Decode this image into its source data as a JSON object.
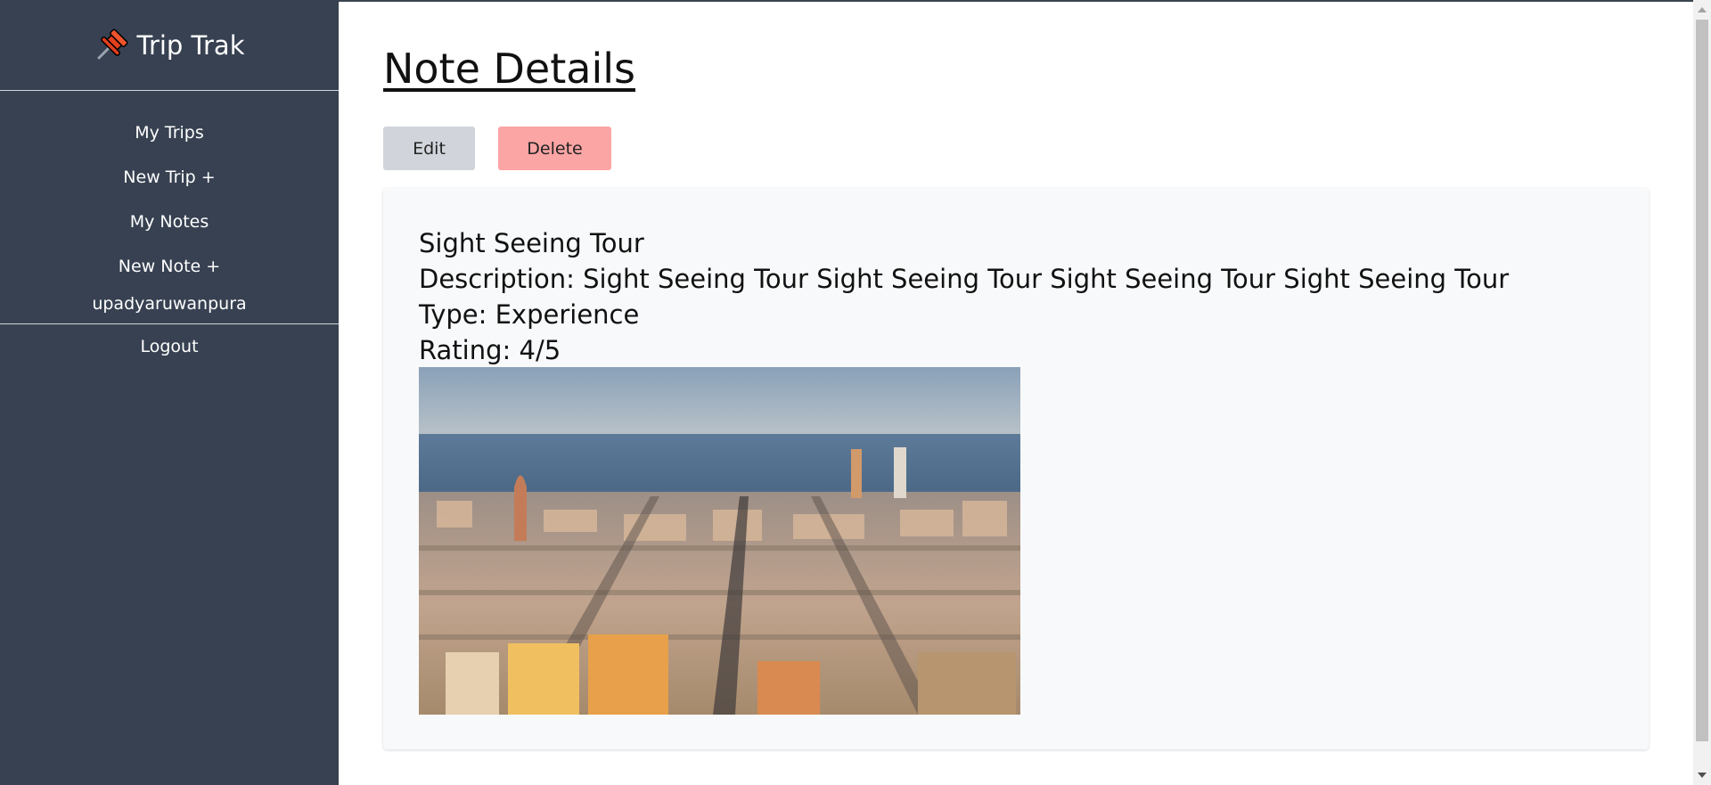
{
  "sidebar": {
    "brand": "Trip Trak",
    "nav": [
      {
        "label": "My Trips"
      },
      {
        "label": "New Trip +"
      },
      {
        "label": "My Notes"
      },
      {
        "label": "New Note +"
      }
    ],
    "username": "upadyaruwanpura",
    "logout": "Logout"
  },
  "main": {
    "title": "Note Details",
    "edit_label": "Edit",
    "delete_label": "Delete",
    "note": {
      "name": "Sight Seeing Tour",
      "description": "Description: Sight Seeing Tour Sight Seeing Tour Sight Seeing Tour Sight Seeing Tour",
      "type": "Type: Experience",
      "rating": "Rating: 4/5"
    }
  },
  "colors": {
    "sidebar_bg": "#374151",
    "edit_bg": "#d1d5db",
    "delete_bg": "#fca5a5",
    "card_bg": "#f8f9fa"
  },
  "icons": {
    "brand": "pushpin-icon"
  }
}
